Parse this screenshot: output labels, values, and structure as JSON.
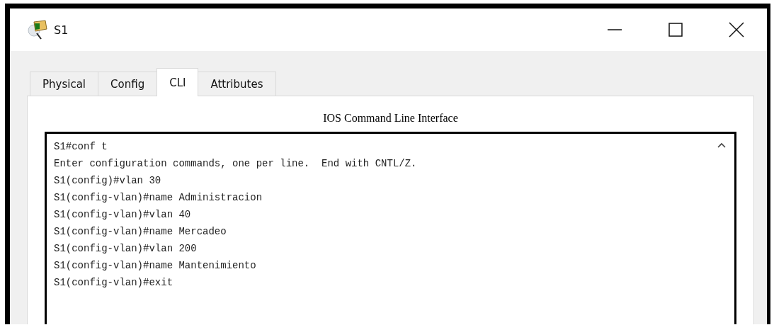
{
  "window": {
    "title": "S1"
  },
  "tabs": [
    {
      "label": "Physical",
      "selected": false
    },
    {
      "label": "Config",
      "selected": false
    },
    {
      "label": "CLI",
      "selected": true
    },
    {
      "label": "Attributes",
      "selected": false
    }
  ],
  "panel": {
    "heading": "IOS Command Line Interface"
  },
  "terminal": {
    "lines": [
      "S1#conf t",
      "Enter configuration commands, one per line.  End with CNTL/Z.",
      "S1(config)#vlan 30",
      "S1(config-vlan)#name Administracion",
      "S1(config-vlan)#vlan 40",
      "S1(config-vlan)#name Mercadeo",
      "S1(config-vlan)#vlan 200",
      "S1(config-vlan)#name Mantenimiento",
      "S1(config-vlan)#exit"
    ]
  }
}
